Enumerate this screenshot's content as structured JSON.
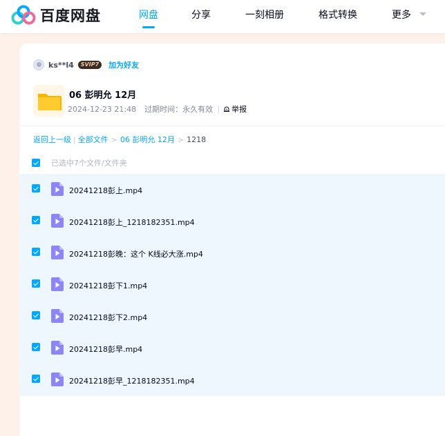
{
  "brand": {
    "name": "百度网盘",
    "colors": {
      "blue": "#06a7ff",
      "teal": "#2fcfd0",
      "pink": "#ef6b9a"
    }
  },
  "nav": {
    "items": [
      {
        "label": "网盘",
        "active": true
      },
      {
        "label": "分享",
        "active": false
      },
      {
        "label": "一刻相册",
        "active": false
      },
      {
        "label": "格式转换",
        "active": false
      },
      {
        "label": "更多",
        "active": false
      }
    ]
  },
  "sharer": {
    "username": "ks**l4",
    "vip_badge": "SVIP7",
    "add_friend": "加为好友"
  },
  "share": {
    "folder_icon": "folder-icon",
    "title": "06 彭明允 12月",
    "date": "2024-12-23 21:48",
    "expiry": "过期时间：永久有效",
    "report": "举报"
  },
  "breadcrumb": {
    "back": "返回上一级",
    "all_files": "全部文件",
    "folder": "06 彭明允 12月",
    "current": "1218"
  },
  "selection": {
    "summary": "已选中7个文件/文件夹",
    "all_checked": true
  },
  "files": [
    {
      "name": "20241218彭上.mp4",
      "checked": true,
      "icon": "video-file-icon"
    },
    {
      "name": "20241218彭上_1218182351.mp4",
      "checked": true,
      "icon": "video-file-icon"
    },
    {
      "name": "20241218彭晚：这个 K线必大涨.mp4",
      "checked": true,
      "icon": "video-file-icon"
    },
    {
      "name": "20241218彭下1.mp4",
      "checked": true,
      "icon": "video-file-icon"
    },
    {
      "name": "20241218彭下2.mp4",
      "checked": true,
      "icon": "video-file-icon"
    },
    {
      "name": "20241218彭早.mp4",
      "checked": true,
      "icon": "video-file-icon"
    },
    {
      "name": "20241218彭早_1218182351.mp4",
      "checked": true,
      "icon": "video-file-icon"
    }
  ]
}
